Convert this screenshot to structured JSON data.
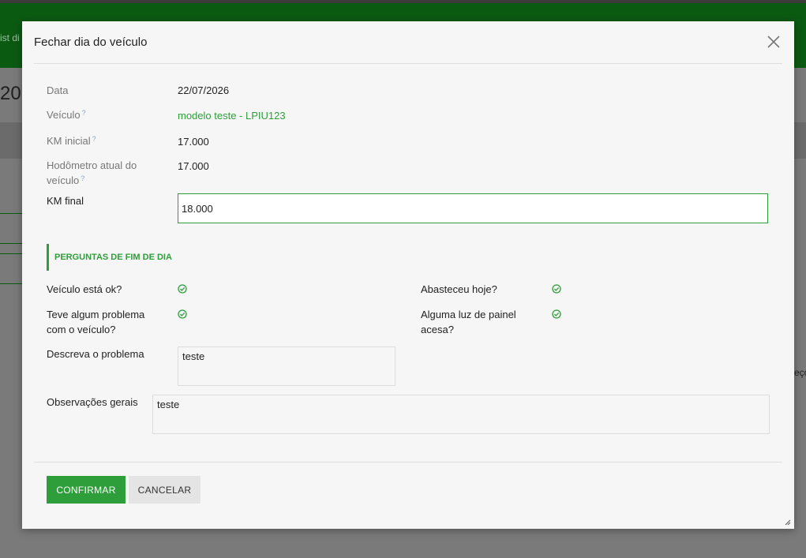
{
  "background": {
    "header_text": "ist di",
    "page_title": "20",
    "right_text": "eço"
  },
  "modal": {
    "title": "Fechar dia do veículo",
    "close_icon": "close-icon",
    "fields": {
      "data_label": "Data",
      "data_value": "22/07/2026",
      "veiculo_label": "Veículo",
      "veiculo_value": "modelo teste - LPIU123",
      "km_inicial_label": "KM inicial",
      "km_inicial_value": "17.000",
      "hodometro_label_line1": "Hodômetro atual do",
      "hodometro_label_line2": "veículo",
      "hodometro_value": "17.000",
      "km_final_label": "KM final",
      "km_final_value": "18.000",
      "help_mark": "?"
    },
    "section_title": "PERGUNTAS DE FIM DE DIA",
    "questions": {
      "q1_label": "Veículo está ok?",
      "q2_label": "Abasteceu hoje?",
      "q3_label_line1": "Teve algum problema",
      "q3_label_line2": "com o veículo?",
      "q4_label_line1": "Alguma luz de painel",
      "q4_label_line2": "acesa?",
      "check_icon": "check-circle-icon"
    },
    "descreva_label": "Descreva o problema",
    "descreva_value": "teste",
    "observacoes_label": "Observações gerais",
    "observacoes_value": "teste",
    "buttons": {
      "confirm": "CONFIRMAR",
      "cancel": "CANCELAR"
    }
  },
  "colors": {
    "accent": "#2e9e3a",
    "header_bg": "#0b5a12",
    "overlay": "#6f6f6f"
  }
}
